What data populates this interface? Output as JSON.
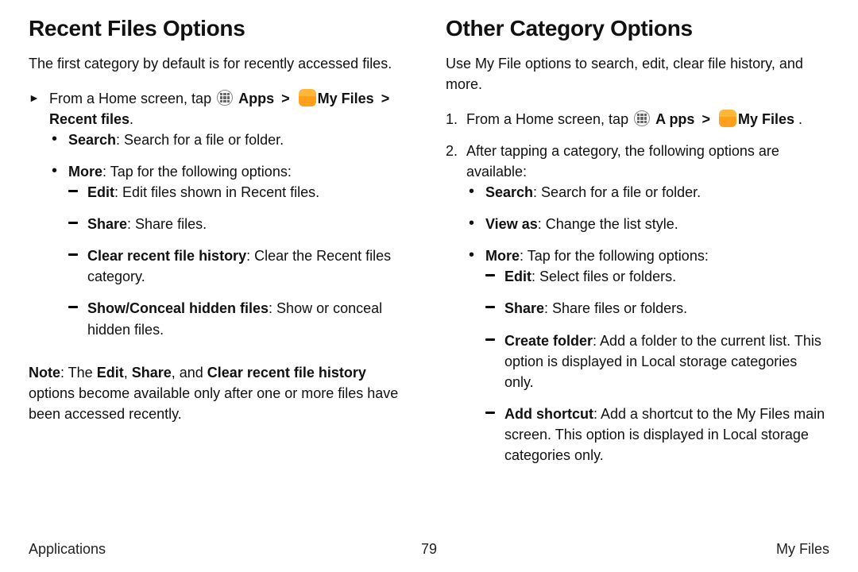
{
  "left": {
    "heading": "Recent Files Options",
    "intro": "The first category by default is for recently accessed files.",
    "step_prefix": "From a Home screen, tap",
    "apps_label": "Apps",
    "myfiles_label": "My Files",
    "recent_label": "Recent files",
    "period": ".",
    "search_label": "Search",
    "search_desc": ": Search for a file or folder.",
    "more_label": "More",
    "more_desc": ": Tap for the following options:",
    "edit_label": "Edit",
    "edit_desc": ": Edit files shown in Recent files.",
    "share_label": "Share",
    "share_desc": ": Share files.",
    "clear_label": "Clear recent file history",
    "clear_desc": ": Clear the Recent files category.",
    "show_label": "Show/Conceal hidden files",
    "show_desc": ": Show or conceal hidden files.",
    "note_label": "Note",
    "note_pre": ": The ",
    "note_edit": "Edit",
    "note_sep1": ", ",
    "note_share": "Share",
    "note_sep2": ", and ",
    "note_clear": "Clear recent file history",
    "note_post": " options become available only after one or more files have been accessed recently."
  },
  "right": {
    "heading": "Other Category Options",
    "intro": "Use My File options to search, edit, clear file history, and more.",
    "num1": "1.",
    "num2": "2.",
    "step1_prefix": "From a Home screen, tap",
    "apps_label": "A pps",
    "myfiles_label": "My Files",
    "period": " .",
    "step2": "After tapping a category, the following options are available:",
    "search_label": "Search",
    "search_desc": ": Search for a file or folder.",
    "view_label": "View as",
    "view_desc": ": Change the list style.",
    "more_label": "More",
    "more_desc": ": Tap for the following options:",
    "edit_label": "Edit",
    "edit_desc": ": Select files or folders.",
    "share_label": "Share",
    "share_desc": ": Share files or folders.",
    "create_label": "Create folder",
    "create_desc": ": Add a folder to the current list. This option is displayed in Local storage categories only.",
    "add_label": "Add shortcut",
    "add_desc": ": Add a shortcut to the My Files main screen. This option is displayed in Local storage categories only."
  },
  "footer": {
    "left": "Applications",
    "page": "79",
    "right": "My Files"
  },
  "glyphs": {
    "chevron": ">"
  }
}
